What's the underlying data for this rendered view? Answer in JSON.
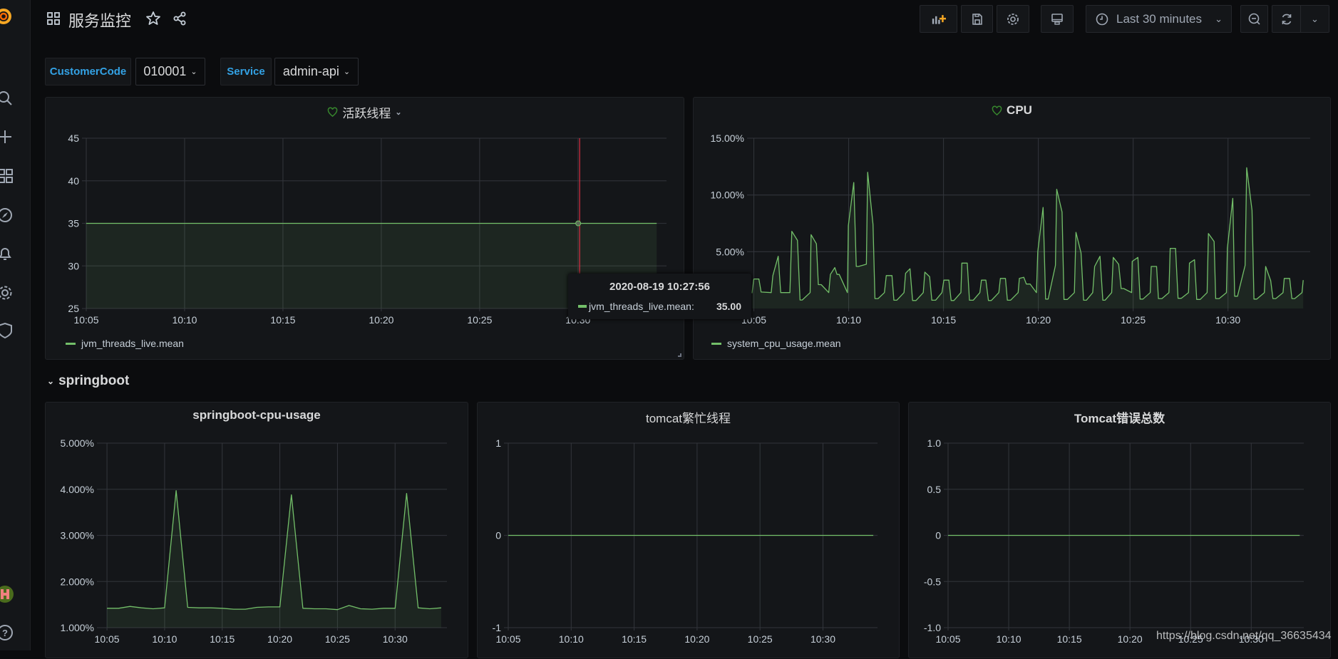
{
  "app": {
    "title": "服务监控",
    "accent": "#f46800"
  },
  "sidebar": {
    "items": [
      "grafana-logo",
      "search",
      "create",
      "dashboards",
      "explore",
      "alerting",
      "configuration",
      "server-admin",
      "user-avatar",
      "help"
    ]
  },
  "toolbar": {
    "time_range": "Last 30 minutes",
    "buttons": [
      "add-panel",
      "save-dashboard",
      "dashboard-settings",
      "cycle-view-mode",
      "time-picker",
      "zoom-out",
      "refresh",
      "refresh-interval"
    ]
  },
  "variables": [
    {
      "label": "CustomerCode",
      "value": "010001"
    },
    {
      "label": "Service",
      "value": "admin-api"
    }
  ],
  "row": {
    "title": "springboot"
  },
  "watermark": "https://blog.csdn.net/qq_36635434",
  "colors": {
    "series": "#73BF69",
    "background": "#0b0c0e",
    "panel": "#141619",
    "variable_label": "#33a2e5",
    "cursor": "#e02f44"
  },
  "chart_data": [
    {
      "type": "line",
      "title": "活跃线程",
      "fill": true,
      "legend": "bottom-left",
      "grid": true,
      "xlim": [
        "10:05:00",
        "10:34:30"
      ],
      "ylim": [
        25,
        45
      ],
      "yticks": [
        {
          "value": 25,
          "label": "25"
        },
        {
          "value": 30,
          "label": "30"
        },
        {
          "value": 35,
          "label": "35"
        },
        {
          "value": 40,
          "label": "40"
        },
        {
          "value": 45,
          "label": "45"
        }
      ],
      "xticks": [
        "10:05",
        "10:10",
        "10:15",
        "10:20",
        "10:25",
        "10:30"
      ],
      "series": [
        {
          "name": "jvm_threads_live.mean",
          "points": [
            [
              "10:05:00",
              35
            ],
            [
              "10:34:00",
              35
            ]
          ]
        }
      ],
      "tooltip": {
        "time": "2020-08-19 10:27:56",
        "series": "jvm_threads_live.mean:",
        "value": "35.00"
      }
    },
    {
      "type": "line",
      "title": "CPU",
      "fill": true,
      "legend": "bottom-left",
      "grid": true,
      "xlim": [
        "10:04:52",
        "10:34:20"
      ],
      "ylim": [
        0,
        15
      ],
      "yticks": [
        {
          "value": 5,
          "label": "5.00%"
        },
        {
          "value": 10,
          "label": "10.00%"
        },
        {
          "value": 15,
          "label": "15.00%"
        }
      ],
      "xticks": [
        "10:05",
        "10:10",
        "10:15",
        "10:20",
        "10:25",
        "10:30"
      ],
      "series": [
        {
          "name": "system_cpu_usage.mean",
          "points": [
            [
              "10:04:54",
              1.35
            ],
            [
              "10:05:00",
              2.6
            ],
            [
              "10:05:16",
              2.6
            ],
            [
              "10:05:23",
              1.45
            ],
            [
              "10:05:55",
              1.4
            ],
            [
              "10:06:00",
              2.9
            ],
            [
              "10:06:17",
              4.6
            ],
            [
              "10:06:25",
              1.4
            ],
            [
              "10:06:54",
              1.4
            ],
            [
              "10:07:00",
              6.8
            ],
            [
              "10:07:18",
              6.0
            ],
            [
              "10:07:26",
              0.75
            ],
            [
              "10:07:33",
              0.75
            ],
            [
              "10:07:58",
              1.4
            ],
            [
              "10:08:01",
              6.5
            ],
            [
              "10:08:18",
              5.7
            ],
            [
              "10:08:24",
              2.1
            ],
            [
              "10:08:33",
              2.1
            ],
            [
              "10:08:57",
              1.4
            ],
            [
              "10:09:02",
              3.0
            ],
            [
              "10:09:16",
              3.6
            ],
            [
              "10:09:23",
              3.0
            ],
            [
              "10:09:30",
              3.0
            ],
            [
              "10:09:56",
              1.4
            ],
            [
              "10:09:59",
              7.3
            ],
            [
              "10:10:16",
              11.1
            ],
            [
              "10:10:24",
              3.7
            ],
            [
              "10:10:31",
              3.7
            ],
            [
              "10:10:56",
              3.9
            ],
            [
              "10:11:00",
              12.0
            ],
            [
              "10:11:17",
              7.4
            ],
            [
              "10:11:23",
              0.87
            ],
            [
              "10:11:33",
              0.87
            ],
            [
              "10:11:53",
              1.4
            ],
            [
              "10:11:59",
              2.9
            ],
            [
              "10:12:17",
              2.9
            ],
            [
              "10:12:23",
              0.73
            ],
            [
              "10:12:32",
              0.73
            ],
            [
              "10:12:55",
              1.4
            ],
            [
              "10:13:00",
              3.1
            ],
            [
              "10:13:14",
              3.5
            ],
            [
              "10:13:22",
              0.7
            ],
            [
              "10:13:33",
              0.7
            ],
            [
              "10:13:56",
              1.4
            ],
            [
              "10:14:01",
              3.2
            ],
            [
              "10:14:16",
              2.8
            ],
            [
              "10:14:23",
              0.73
            ],
            [
              "10:14:35",
              0.73
            ],
            [
              "10:14:55",
              1.4
            ],
            [
              "10:15:01",
              2.5
            ],
            [
              "10:15:17",
              2.5
            ],
            [
              "10:15:24",
              0.7
            ],
            [
              "10:15:33",
              0.7
            ],
            [
              "10:15:55",
              1.4
            ],
            [
              "10:15:58",
              4.0
            ],
            [
              "10:16:15",
              4.0
            ],
            [
              "10:16:22",
              0.73
            ],
            [
              "10:16:34",
              0.73
            ],
            [
              "10:16:55",
              1.4
            ],
            [
              "10:17:00",
              2.5
            ],
            [
              "10:17:14",
              2.5
            ],
            [
              "10:17:22",
              0.7
            ],
            [
              "10:17:31",
              0.7
            ],
            [
              "10:17:55",
              1.4
            ],
            [
              "10:18:00",
              2.65
            ],
            [
              "10:18:16",
              2.65
            ],
            [
              "10:18:22",
              0.73
            ],
            [
              "10:18:32",
              0.73
            ],
            [
              "10:18:56",
              1.4
            ],
            [
              "10:19:00",
              2.65
            ],
            [
              "10:19:14",
              2.75
            ],
            [
              "10:19:22",
              2.15
            ],
            [
              "10:19:34",
              2.15
            ],
            [
              "10:19:54",
              1.4
            ],
            [
              "10:19:58",
              5.0
            ],
            [
              "10:20:15",
              8.9
            ],
            [
              "10:20:23",
              0.83
            ],
            [
              "10:20:31",
              0.83
            ],
            [
              "10:20:54",
              3.8
            ],
            [
              "10:20:58",
              10.5
            ],
            [
              "10:21:15",
              8.5
            ],
            [
              "10:21:21",
              0.8
            ],
            [
              "10:21:32",
              0.8
            ],
            [
              "10:21:54",
              1.4
            ],
            [
              "10:21:59",
              6.7
            ],
            [
              "10:22:15",
              4.9
            ],
            [
              "10:22:23",
              0.73
            ],
            [
              "10:22:32",
              0.73
            ],
            [
              "10:22:52",
              1.4
            ],
            [
              "10:22:58",
              3.7
            ],
            [
              "10:23:15",
              4.6
            ],
            [
              "10:23:24",
              0.73
            ],
            [
              "10:23:31",
              0.73
            ],
            [
              "10:23:52",
              1.4
            ],
            [
              "10:23:57",
              4.5
            ],
            [
              "10:24:14",
              3.9
            ],
            [
              "10:24:22",
              1.76
            ],
            [
              "10:24:30",
              1.76
            ],
            [
              "10:24:55",
              1.4
            ],
            [
              "10:24:57",
              4.15
            ],
            [
              "10:25:15",
              4.5
            ],
            [
              "10:25:22",
              0.83
            ],
            [
              "10:25:31",
              0.83
            ],
            [
              "10:25:54",
              1.4
            ],
            [
              "10:25:57",
              3.7
            ],
            [
              "10:26:14",
              3.7
            ],
            [
              "10:26:20",
              0.87
            ],
            [
              "10:26:31",
              0.87
            ],
            [
              "10:26:53",
              1.4
            ],
            [
              "10:26:57",
              5.3
            ],
            [
              "10:27:14",
              5.3
            ],
            [
              "10:27:22",
              0.9
            ],
            [
              "10:27:32",
              0.9
            ],
            [
              "10:27:55",
              1.4
            ],
            [
              "10:27:58",
              4.0
            ],
            [
              "10:28:14",
              4.3
            ],
            [
              "10:28:21",
              0.8
            ],
            [
              "10:28:32",
              0.8
            ],
            [
              "10:28:54",
              1.4
            ],
            [
              "10:28:58",
              6.6
            ],
            [
              "10:29:16",
              5.9
            ],
            [
              "10:29:21",
              0.87
            ],
            [
              "10:29:32",
              0.87
            ],
            [
              "10:29:55",
              1.4
            ],
            [
              "10:29:58",
              5.3
            ],
            [
              "10:30:15",
              9.7
            ],
            [
              "10:30:21",
              1.08
            ],
            [
              "10:30:30",
              1.08
            ],
            [
              "10:30:54",
              3.8
            ],
            [
              "10:30:59",
              12.4
            ],
            [
              "10:31:16",
              8.65
            ],
            [
              "10:31:22",
              0.83
            ],
            [
              "10:31:31",
              0.83
            ],
            [
              "10:31:55",
              1.4
            ],
            [
              "10:31:59",
              3.7
            ],
            [
              "10:32:15",
              2.45
            ],
            [
              "10:32:22",
              0.87
            ],
            [
              "10:32:31",
              0.87
            ],
            [
              "10:32:54",
              1.4
            ],
            [
              "10:32:58",
              2.65
            ],
            [
              "10:33:15",
              2.65
            ],
            [
              "10:33:22",
              0.87
            ],
            [
              "10:33:31",
              0.87
            ],
            [
              "10:33:54",
              1.4
            ],
            [
              "10:33:58",
              2.5
            ]
          ]
        }
      ]
    },
    {
      "type": "line",
      "title": "springboot-cpu-usage",
      "fill": true,
      "legend": "none",
      "grid": true,
      "xlim": [
        "10:04:30",
        "10:34:30"
      ],
      "ylim": [
        1,
        5
      ],
      "yticks": [
        {
          "value": 1,
          "label": "1.000%"
        },
        {
          "value": 2,
          "label": "2.000%"
        },
        {
          "value": 3,
          "label": "3.000%"
        },
        {
          "value": 4,
          "label": "4.000%"
        },
        {
          "value": 5,
          "label": "5.000%"
        }
      ],
      "xticks": [
        "10:05",
        "10:10",
        "10:15",
        "10:20",
        "10:25",
        "10:30"
      ],
      "series": [
        {
          "points": [
            [
              "10:05:00",
              1.42
            ],
            [
              "10:06:00",
              1.42
            ],
            [
              "10:07:00",
              1.46
            ],
            [
              "10:08:00",
              1.43
            ],
            [
              "10:09:00",
              1.41
            ],
            [
              "10:10:00",
              1.43
            ],
            [
              "10:11:00",
              3.97
            ],
            [
              "10:12:00",
              1.44
            ],
            [
              "10:13:00",
              1.43
            ],
            [
              "10:14:00",
              1.43
            ],
            [
              "10:15:00",
              1.42
            ],
            [
              "10:16:00",
              1.4
            ],
            [
              "10:17:00",
              1.4
            ],
            [
              "10:18:00",
              1.44
            ],
            [
              "10:19:00",
              1.45
            ],
            [
              "10:20:00",
              1.45
            ],
            [
              "10:21:00",
              3.88
            ],
            [
              "10:22:00",
              1.42
            ],
            [
              "10:23:00",
              1.41
            ],
            [
              "10:24:00",
              1.41
            ],
            [
              "10:25:00",
              1.39
            ],
            [
              "10:26:00",
              1.48
            ],
            [
              "10:27:00",
              1.41
            ],
            [
              "10:28:00",
              1.4
            ],
            [
              "10:29:00",
              1.42
            ],
            [
              "10:30:00",
              1.42
            ],
            [
              "10:31:00",
              3.91
            ],
            [
              "10:32:00",
              1.43
            ],
            [
              "10:33:00",
              1.41
            ],
            [
              "10:34:00",
              1.43
            ]
          ]
        }
      ]
    },
    {
      "type": "line",
      "title": "tomcat繁忙线程",
      "fill": false,
      "legend": "none",
      "grid": true,
      "xlim": [
        "10:05:00",
        "10:34:20"
      ],
      "ylim": [
        -1,
        1
      ],
      "yticks": [
        {
          "value": -1,
          "label": "-1"
        },
        {
          "value": 0,
          "label": "0"
        },
        {
          "value": 1,
          "label": "1"
        }
      ],
      "xticks": [
        "10:05",
        "10:10",
        "10:15",
        "10:20",
        "10:25",
        "10:30"
      ],
      "series": [
        {
          "points": [
            [
              "10:05:00",
              0
            ],
            [
              "10:34:00",
              0
            ]
          ]
        }
      ]
    },
    {
      "type": "line",
      "title": "Tomcat错误总数",
      "fill": false,
      "legend": "none",
      "grid": true,
      "xlim": [
        "10:05:00",
        "10:34:20"
      ],
      "ylim": [
        -1,
        1
      ],
      "yticks": [
        {
          "value": -1,
          "label": "-1.0"
        },
        {
          "value": -0.5,
          "label": "-0.5"
        },
        {
          "value": 0,
          "label": "0"
        },
        {
          "value": 0.5,
          "label": "0.5"
        },
        {
          "value": 1,
          "label": "1.0"
        }
      ],
      "xticks": [
        "10:05",
        "10:10",
        "10:15",
        "10:20",
        "10:25",
        "10:30"
      ],
      "series": [
        {
          "points": [
            [
              "10:05:00",
              0
            ],
            [
              "10:34:00",
              0
            ]
          ]
        }
      ]
    }
  ]
}
